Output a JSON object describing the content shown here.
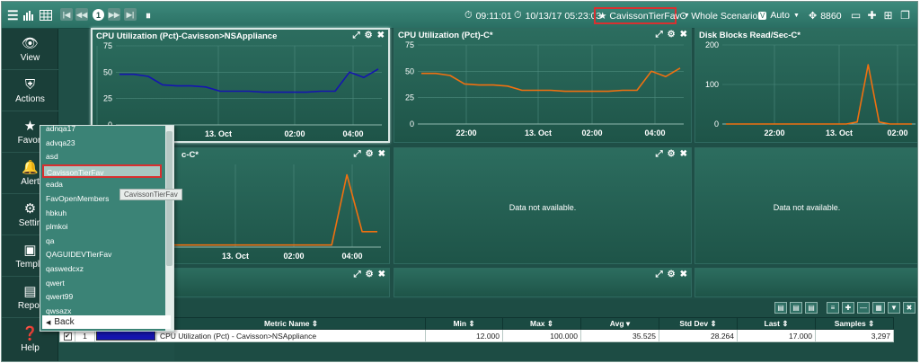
{
  "toolbar": {
    "page_number": "1",
    "pause_icon": "⏸",
    "time": "09:11:01",
    "datetime": "10/13/17 05:23:03",
    "favorite": "CavissonTierFav",
    "scenario": "Whole Scenario",
    "auto": "Auto",
    "port": "8860"
  },
  "sidebar": {
    "items": [
      {
        "label": "View",
        "icon": "eye-icon"
      },
      {
        "label": "Actions",
        "icon": "shield-icon"
      },
      {
        "label": "Favori",
        "icon": "star-icon"
      },
      {
        "label": "Alert",
        "icon": "bell-icon"
      },
      {
        "label": "Settin",
        "icon": "gear-icon"
      },
      {
        "label": "Templa",
        "icon": "template-icon"
      },
      {
        "label": "Repor",
        "icon": "report-icon"
      },
      {
        "label": "Help",
        "icon": "help-icon"
      }
    ]
  },
  "panels": [
    {
      "title": "CPU Utilization (Pct)-Cavisson>NSAppliance"
    },
    {
      "title": "CPU Utilization (Pct)-C*"
    },
    {
      "title": "Disk Blocks Read/Sec-C*"
    },
    {
      "title": "c-C*"
    },
    {
      "message": "Data not available."
    },
    {
      "message": "Data not available."
    }
  ],
  "chart_data": [
    {
      "type": "line",
      "title": "CPU Utilization (Pct)-Cavisson>NSAppliance",
      "xlabel": "",
      "ylabel": "",
      "ylim": [
        0,
        75
      ],
      "yticks": [
        "75",
        "50",
        "25",
        "0"
      ],
      "xticks": [
        "0",
        "13. Oct",
        "02:00",
        "04:00"
      ],
      "grid": true,
      "series": [
        {
          "color": "#1515b0",
          "values": [
            48,
            48,
            46,
            38,
            37,
            37,
            36,
            32,
            32,
            32,
            31,
            31,
            31,
            31,
            32,
            32,
            50,
            45,
            53
          ]
        }
      ]
    },
    {
      "type": "line",
      "title": "CPU Utilization (Pct)-C*",
      "xlabel": "",
      "ylabel": "",
      "ylim": [
        0,
        75
      ],
      "yticks": [
        "75",
        "50",
        "25",
        "0"
      ],
      "xticks": [
        "22:00",
        "13. Oct",
        "02:00",
        "04:00"
      ],
      "grid": true,
      "series": [
        {
          "color": "#f07010",
          "values": [
            48,
            48,
            46,
            38,
            37,
            37,
            36,
            32,
            32,
            32,
            31,
            31,
            31,
            31,
            32,
            32,
            50,
            45,
            53
          ]
        }
      ]
    },
    {
      "type": "line",
      "title": "Disk Blocks Read/Sec-C*",
      "xlabel": "",
      "ylabel": "",
      "ylim": [
        0,
        200
      ],
      "yticks": [
        "200",
        "100",
        "0"
      ],
      "xticks": [
        "22:00",
        "13. Oct",
        "02:00"
      ],
      "grid": true,
      "series": [
        {
          "color": "#f07010",
          "values": [
            0,
            0,
            0,
            0,
            0,
            0,
            0,
            0,
            0,
            0,
            0,
            0,
            5,
            150,
            5,
            0,
            0,
            0
          ]
        }
      ]
    },
    {
      "type": "line",
      "title": "c-C*",
      "xlabel": "",
      "ylabel": "",
      "xticks": [
        "13. Oct",
        "02:00",
        "04:00"
      ],
      "grid": true,
      "series": [
        {
          "color": "#f07010",
          "values": [
            2,
            2,
            2,
            2,
            2,
            2,
            2,
            2,
            2,
            2,
            2,
            2,
            2,
            2,
            2,
            70,
            15,
            15
          ]
        }
      ]
    }
  ],
  "dropdown": {
    "items": [
      "adnqa17",
      "advqa23",
      "asd",
      "CavissonTierFav",
      "eada",
      "FavOpenMembers",
      "hbkuh",
      "plmkoi",
      "qa",
      "QAGUIDEVTierFav",
      "qaswedcxz",
      "qwert",
      "qwert99",
      "qwsazx"
    ],
    "selected_index": 3,
    "back_label": "Back",
    "tooltip": "CavissonTierFav"
  },
  "table": {
    "columns": [
      "Metric Name",
      "Min",
      "Max",
      "Avg",
      "Std Dev",
      "Last",
      "Samples"
    ],
    "rows": [
      {
        "checked": true,
        "index": "1",
        "color": "#1515b0",
        "metric": "CPU Utilization (Pct) - Cavisson>NSAppliance",
        "min": "12.000",
        "max": "100.000",
        "avg": "35.525",
        "std": "28.264",
        "last": "17.000",
        "samples": "3,297"
      }
    ]
  }
}
